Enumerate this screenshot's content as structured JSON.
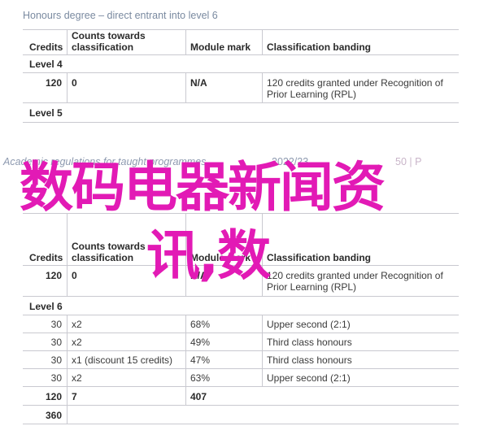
{
  "section1": {
    "heading": "Honours degree – direct entrant into level 6",
    "headers": {
      "credits": "Credits",
      "counts": "Counts towards classification",
      "module_mark": "Module mark",
      "banding": "Classification banding"
    },
    "level4": "Level 4",
    "row": {
      "credits": "120",
      "counts": "0",
      "module_mark": "N/A",
      "banding": "120 credits granted under Recognition of Prior Learning (RPL)"
    },
    "level5": "Level 5"
  },
  "section2": {
    "heading_left": "Academic regulations for taught programmes",
    "heading_mid": "2022/23",
    "heading_right": "50 | P",
    "headers": {
      "credits": "Credits",
      "counts": "Counts towards classification",
      "module_mark": "Module mark",
      "banding": "Classification banding"
    },
    "row_level5": {
      "credits": "120",
      "counts": "0",
      "module_mark": "N/A",
      "banding": "120 credits granted under Recognition of Prior Learning (RPL)"
    },
    "level6": "Level 6",
    "rows": [
      {
        "credits": "30",
        "counts": "x2",
        "module_mark": "68%",
        "banding": "Upper second (2:1)"
      },
      {
        "credits": "30",
        "counts": "x2",
        "module_mark": "49%",
        "banding": "Third class honours"
      },
      {
        "credits": "30",
        "counts": "x1 (discount 15 credits)",
        "module_mark": "47%",
        "banding": "Third class honours"
      },
      {
        "credits": "30",
        "counts": "x2",
        "module_mark": "63%",
        "banding": "Upper second (2:1)"
      }
    ],
    "total": {
      "credits": "120",
      "counts": "7",
      "module_mark": "407"
    },
    "grand_total": "360"
  },
  "watermark": {
    "line1": "数码电器新闻资",
    "line2": "讯,数"
  }
}
